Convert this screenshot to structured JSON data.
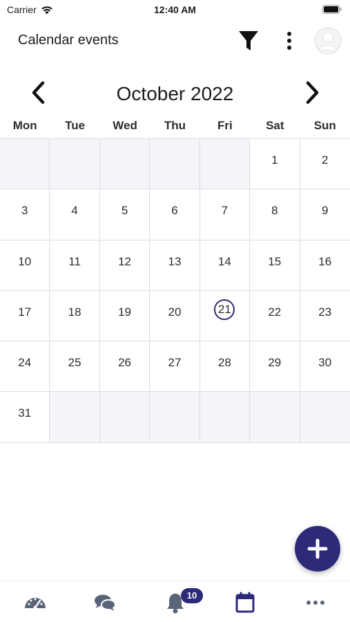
{
  "status_bar": {
    "carrier": "Carrier",
    "time": "12:40 AM",
    "wifi_icon": "wifi-icon",
    "battery_icon": "battery-icon"
  },
  "app_bar": {
    "title": "Calendar events",
    "filter_icon": "filter-icon",
    "more_icon": "more-vert-icon",
    "avatar_icon": "avatar-placeholder-icon"
  },
  "calendar": {
    "month_label": "October 2022",
    "prev_icon": "chevron-left-icon",
    "next_icon": "chevron-right-icon",
    "weekdays": [
      "Mon",
      "Tue",
      "Wed",
      "Thu",
      "Fri",
      "Sat",
      "Sun"
    ],
    "today": "21",
    "weeks": [
      [
        "",
        "",
        "",
        "",
        "",
        "1",
        "2"
      ],
      [
        "3",
        "4",
        "5",
        "6",
        "7",
        "8",
        "9"
      ],
      [
        "10",
        "11",
        "12",
        "13",
        "14",
        "15",
        "16"
      ],
      [
        "17",
        "18",
        "19",
        "20",
        "21",
        "22",
        "23"
      ],
      [
        "24",
        "25",
        "26",
        "27",
        "28",
        "29",
        "30"
      ],
      [
        "31",
        "",
        "",
        "",
        "",
        "",
        ""
      ]
    ]
  },
  "fab": {
    "icon": "plus-icon"
  },
  "bottom_nav": {
    "items": [
      {
        "name": "dashboard",
        "icon": "speedometer-icon"
      },
      {
        "name": "messages",
        "icon": "chat-bubbles-icon"
      },
      {
        "name": "notifications",
        "icon": "bell-icon",
        "badge": "10"
      },
      {
        "name": "calendar",
        "icon": "calendar-icon",
        "active": true
      },
      {
        "name": "more",
        "icon": "more-horiz-icon"
      }
    ]
  },
  "colors": {
    "accent": "#2e2a7a",
    "nav_inactive": "#5a6478",
    "grid_line": "#dcdde2",
    "empty_cell": "#f4f5f8"
  }
}
